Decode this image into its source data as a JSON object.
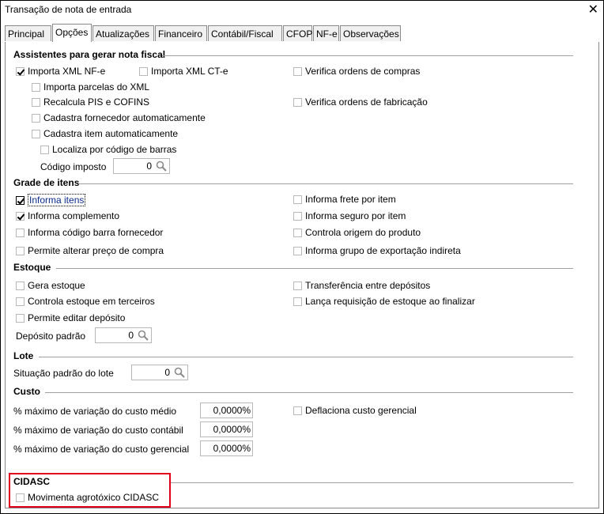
{
  "window": {
    "title": "Transação de nota de entrada",
    "close_label": "✕"
  },
  "tabs": [
    "Principal",
    "Opções",
    "Atualizações",
    "Financeiro",
    "Contábil/Fiscal",
    "CFOP",
    "NF-e",
    "Observações"
  ],
  "sections": {
    "assistentes": {
      "title": "Assistentes para gerar nota fiscal",
      "importa_nfe": "Importa XML NF-e",
      "importa_cte": "Importa XML CT-e",
      "verifica_compras": "Verifica ordens de compras",
      "importa_parcelas": "Importa parcelas do XML",
      "recalcula": "Recalcula PIS e COFINS",
      "verifica_fabricacao": "Verifica ordens de fabricação",
      "cadastra_fornecedor": "Cadastra fornecedor automaticamente",
      "cadastra_item": "Cadastra item automaticamente",
      "localiza_codigo": "Localiza por código de barras",
      "codigo_imposto_label": "Código imposto",
      "codigo_imposto_value": "0"
    },
    "grade": {
      "title": "Grade de itens",
      "informa_itens": "Informa itens",
      "informa_frete": "Informa frete por item",
      "informa_complemento": "Informa complemento",
      "informa_seguro": "Informa seguro por item",
      "informa_codigo_barra": "Informa código barra fornecedor",
      "controla_origem": "Controla origem do produto",
      "permite_alterar_preco": "Permite alterar preço de compra",
      "informa_grupo_exportacao": "Informa grupo de exportação indireta"
    },
    "estoque": {
      "title": "Estoque",
      "gera_estoque": "Gera estoque",
      "transferencia": "Transferência entre depósitos",
      "controla_terceiros": "Controla estoque em terceiros",
      "lanca_requisicao": "Lança requisição de estoque ao finalizar",
      "permite_editar_deposito": "Permite editar depósito",
      "deposito_padrao_label": "Depósito padrão",
      "deposito_padrao_value": "0"
    },
    "lote": {
      "title": "Lote",
      "situacao_label": "Situação padrão do lote",
      "situacao_value": "0"
    },
    "custo": {
      "title": "Custo",
      "medio_label": "% máximo de variação do custo médio",
      "medio_value": "0,0000%",
      "contabil_label": "% máximo de variação do custo contábil",
      "contabil_value": "0,0000%",
      "gerencial_label": "% máximo de variação do custo gerencial",
      "gerencial_value": "0,0000%",
      "deflaciona": "Deflaciona custo gerencial"
    },
    "cidasc": {
      "title": "CIDASC",
      "movimenta": "Movimenta agrotóxico CIDASC"
    }
  },
  "colors": {
    "highlight_box": "#e0001b",
    "focus_text": "#0a2a8a"
  }
}
